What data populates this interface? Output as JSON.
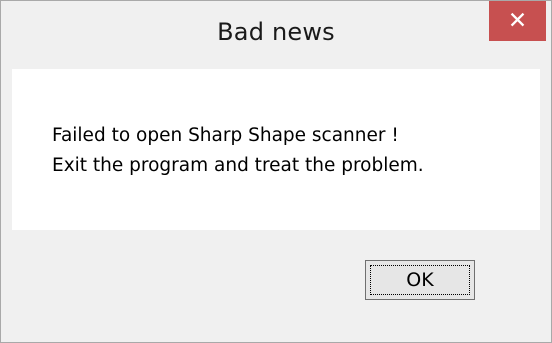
{
  "window": {
    "title": "Bad news",
    "close_glyph": "✕",
    "close_icon": "close-icon"
  },
  "message": {
    "line1": "Failed to open Sharp Shape scanner !",
    "line2": "Exit the program and treat the problem."
  },
  "buttons": {
    "ok_label": "OK"
  },
  "colors": {
    "close_button_bg": "#c75050",
    "frame_bg": "#f0f0f0",
    "content_bg": "#ffffff"
  }
}
